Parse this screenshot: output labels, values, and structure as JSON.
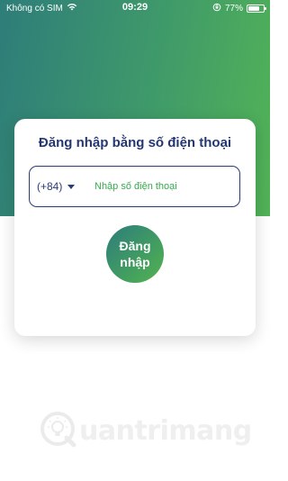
{
  "status_bar": {
    "carrier": "Không có SIM",
    "time": "09:29",
    "battery_percent": "77%",
    "battery_level": 0.77,
    "icons": [
      "wifi-icon",
      "rotation-lock-icon",
      "battery-icon"
    ]
  },
  "login": {
    "title": "Đăng nhập bằng số điện thoại",
    "country_code": "(+84)",
    "phone_placeholder": "Nhập số điện thoại",
    "phone_value": "",
    "button_label": "Đăng nhập"
  },
  "watermark": {
    "text": "uantrimang",
    "logo_icon": "lightbulb-q-logo"
  },
  "colors": {
    "gradient_start": "#2e7d7a",
    "gradient_end": "#52b356",
    "title_color": "#233773",
    "placeholder_color": "#3aa84f"
  }
}
